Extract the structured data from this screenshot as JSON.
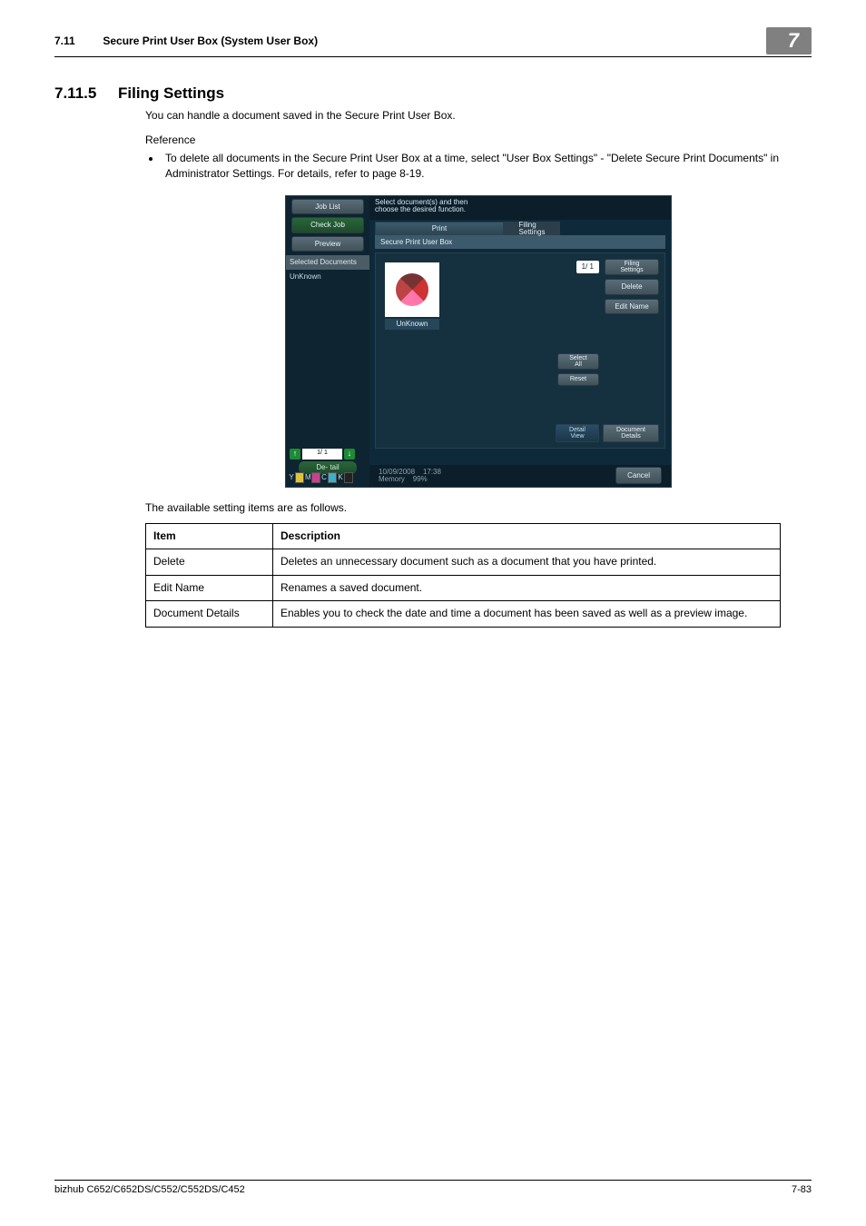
{
  "header": {
    "section_number": "7.11",
    "section_title": "Secure Print User Box (System User Box)",
    "chapter_badge": "7"
  },
  "heading": {
    "number": "7.11.5",
    "title": "Filing Settings"
  },
  "body": {
    "intro": "You can handle a document saved in the Secure Print User Box.",
    "reference_label": "Reference",
    "bullet1": "To delete all documents in the Secure Print User Box at a time, select \"User Box Settings\" - \"Delete Secure Print Documents\" in Administrator Settings. For details, refer to page 8-19.",
    "available_caption": "The available setting items are as follows."
  },
  "screenshot": {
    "left": {
      "job_list": "Job List",
      "check_job": "Check Job",
      "preview": "Preview",
      "selected_documents": "Selected Documents",
      "unknown_item": "UnKnown",
      "page_counter": "1/  1",
      "detail_chip": "De-\ntail",
      "toner_y": "Y",
      "toner_m": "M",
      "toner_c": "C",
      "toner_k": "K"
    },
    "main": {
      "message": "Select document(s) and then\nchoose the desired function.",
      "tab_print": "Print",
      "tab_filing": "Filing\nSettings",
      "breadcrumb": "Secure Print User Box",
      "thumb_caption": "UnKnown",
      "page_indicator": "1/  1",
      "btn_filing": "Filing\nSettings",
      "btn_delete": "Delete",
      "btn_edit_name": "Edit Name",
      "btn_select_all": "Select\nAll",
      "btn_reset": "Reset",
      "btn_detail_view": "Detail\nView",
      "btn_doc_details": "Document\nDetails"
    },
    "bottom": {
      "date": "10/09/2008",
      "time": "17:38",
      "memory_label": "Memory",
      "memory_pct": "99%",
      "cancel": "Cancel"
    }
  },
  "table": {
    "head_item": "Item",
    "head_desc": "Description",
    "rows": [
      {
        "item": "Delete",
        "desc": "Deletes an unnecessary document such as a document that you have printed."
      },
      {
        "item": "Edit Name",
        "desc": "Renames a saved document."
      },
      {
        "item": "Document Details",
        "desc": "Enables you to check the date and time a document has been saved as well as a preview image."
      }
    ]
  },
  "footer": {
    "left": "bizhub C652/C652DS/C552/C552DS/C452",
    "right": "7-83"
  }
}
